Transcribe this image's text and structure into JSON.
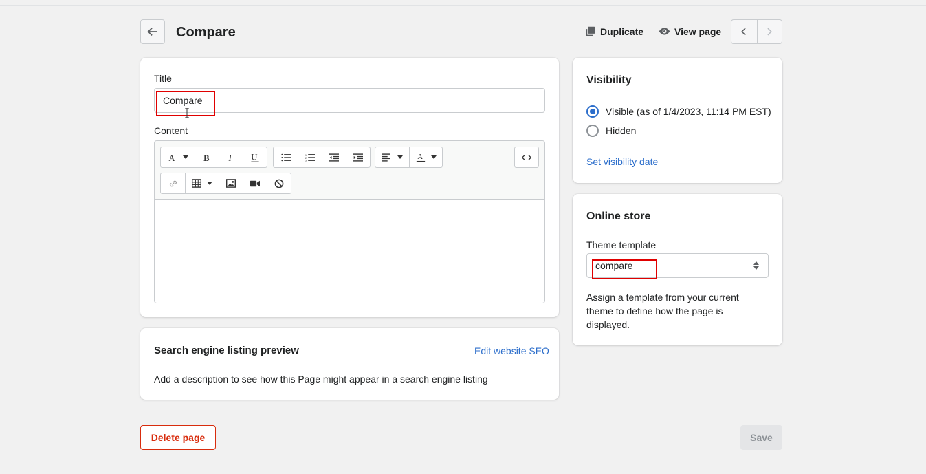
{
  "header": {
    "title": "Compare",
    "duplicate_label": "Duplicate",
    "view_page_label": "View page"
  },
  "page_card": {
    "title_label": "Title",
    "title_value": "Compare",
    "content_label": "Content"
  },
  "seo_card": {
    "heading": "Search engine listing preview",
    "edit_link": "Edit website SEO",
    "description": "Add a description to see how this Page might appear in a search engine listing"
  },
  "visibility_card": {
    "heading": "Visibility",
    "options": [
      {
        "label": "Visible (as of 1/4/2023, 11:14 PM EST)",
        "checked": true
      },
      {
        "label": "Hidden",
        "checked": false
      }
    ],
    "set_date_link": "Set visibility date"
  },
  "online_store_card": {
    "heading": "Online store",
    "template_label": "Theme template",
    "template_value": "compare",
    "help_text": "Assign a template from your current theme to define how the page is displayed."
  },
  "footer": {
    "delete_label": "Delete page",
    "save_label": "Save"
  },
  "colors": {
    "accent": "#2c6ecb",
    "danger": "#d82c0d",
    "highlight": "#e00000"
  },
  "icons": [
    "arrow-left-icon",
    "duplicate-icon",
    "eye-icon",
    "chevron-left-icon",
    "chevron-right-icon",
    "font-icon",
    "bold-icon",
    "italic-icon",
    "underline-icon",
    "bullet-list-icon",
    "numbered-list-icon",
    "outdent-icon",
    "indent-icon",
    "align-icon",
    "text-color-icon",
    "code-icon",
    "link-icon",
    "table-icon",
    "image-icon",
    "video-icon",
    "clear-format-icon",
    "select-arrows-icon"
  ]
}
